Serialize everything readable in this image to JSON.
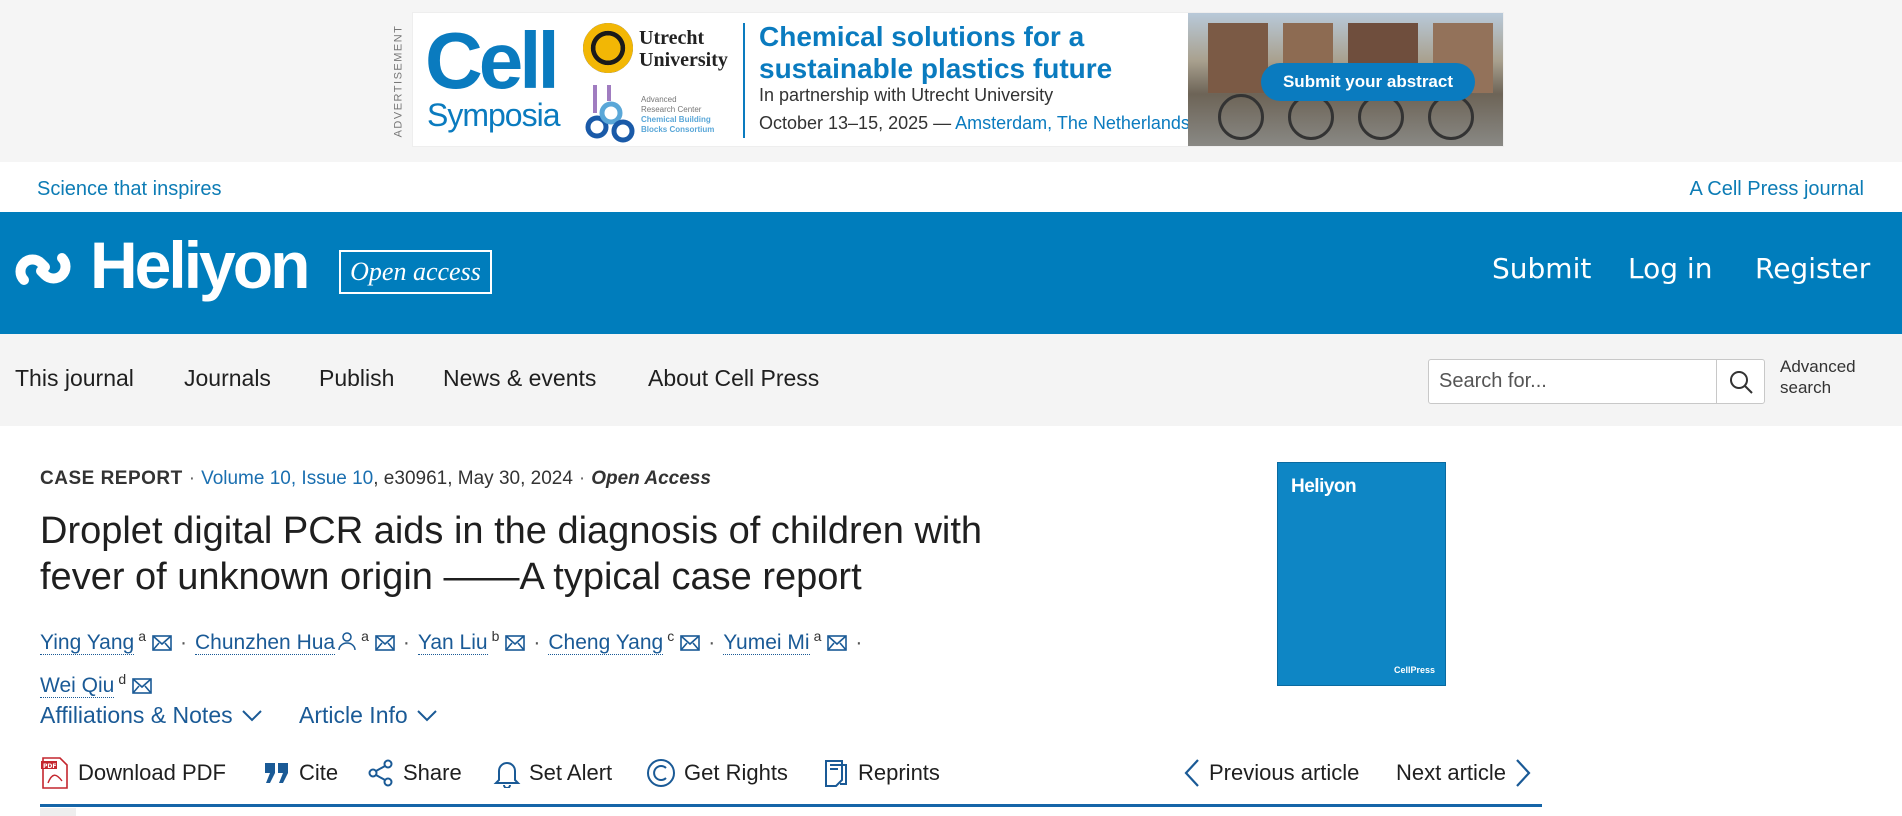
{
  "ad": {
    "label": "ADVERTISEMENT",
    "brand_big": "Cell",
    "brand_small": "Symposia",
    "partner_line1": "Utrecht",
    "partner_line2": "University",
    "arc_text1": "Advanced",
    "arc_text2": "Research Center",
    "arc_text3": "Chemical Building",
    "arc_text4": "Blocks Consortium",
    "headline": "Chemical solutions for a sustainable plastics future",
    "subline": "In partnership with Utrecht University",
    "date": "October 13–15, 2025 —",
    "location": "Amsterdam, The Netherlands",
    "cta": "Submit your abstract"
  },
  "tagline": {
    "left": "Science that inspires",
    "right": "A Cell Press journal"
  },
  "header": {
    "logo": "Heliyon",
    "open_access": "Open access",
    "nav": [
      "Submit",
      "Log in",
      "Register"
    ]
  },
  "nav": {
    "items": [
      "This journal",
      "Journals",
      "Publish",
      "News & events",
      "About Cell Press"
    ],
    "search_placeholder": "Search for...",
    "advanced_line1": "Advanced",
    "advanced_line2": "search"
  },
  "article": {
    "type": "CASE REPORT",
    "volume": "Volume 10, Issue 10",
    "id_date": ", e30961, May 30, 2024",
    "access": "Open Access",
    "title": "Droplet digital PCR aids in the diagnosis of children with fever of unknown origin ——A typical case report",
    "authors": [
      {
        "name": "Ying Yang",
        "aff": "a"
      },
      {
        "name": "Chunzhen Hua",
        "aff": "a"
      },
      {
        "name": "Yan Liu",
        "aff": "b"
      },
      {
        "name": "Cheng Yang",
        "aff": "c"
      },
      {
        "name": "Yumei Mi",
        "aff": "a"
      },
      {
        "name": "Wei Qiu",
        "aff": "d"
      }
    ],
    "affiliations_toggle": "Affiliations & Notes",
    "article_info_toggle": "Article Info",
    "actions": {
      "download": "Download PDF",
      "cite": "Cite",
      "share": "Share",
      "alert": "Set Alert",
      "rights": "Get Rights",
      "reprints": "Reprints",
      "previous": "Previous article",
      "next": "Next article"
    },
    "cover": {
      "title": "Heliyon",
      "publisher": "CellPress"
    }
  },
  "colors": {
    "brand_blue": "#007dbc",
    "link_blue": "#1a5a96",
    "nav_bg": "#f4f4f4"
  }
}
